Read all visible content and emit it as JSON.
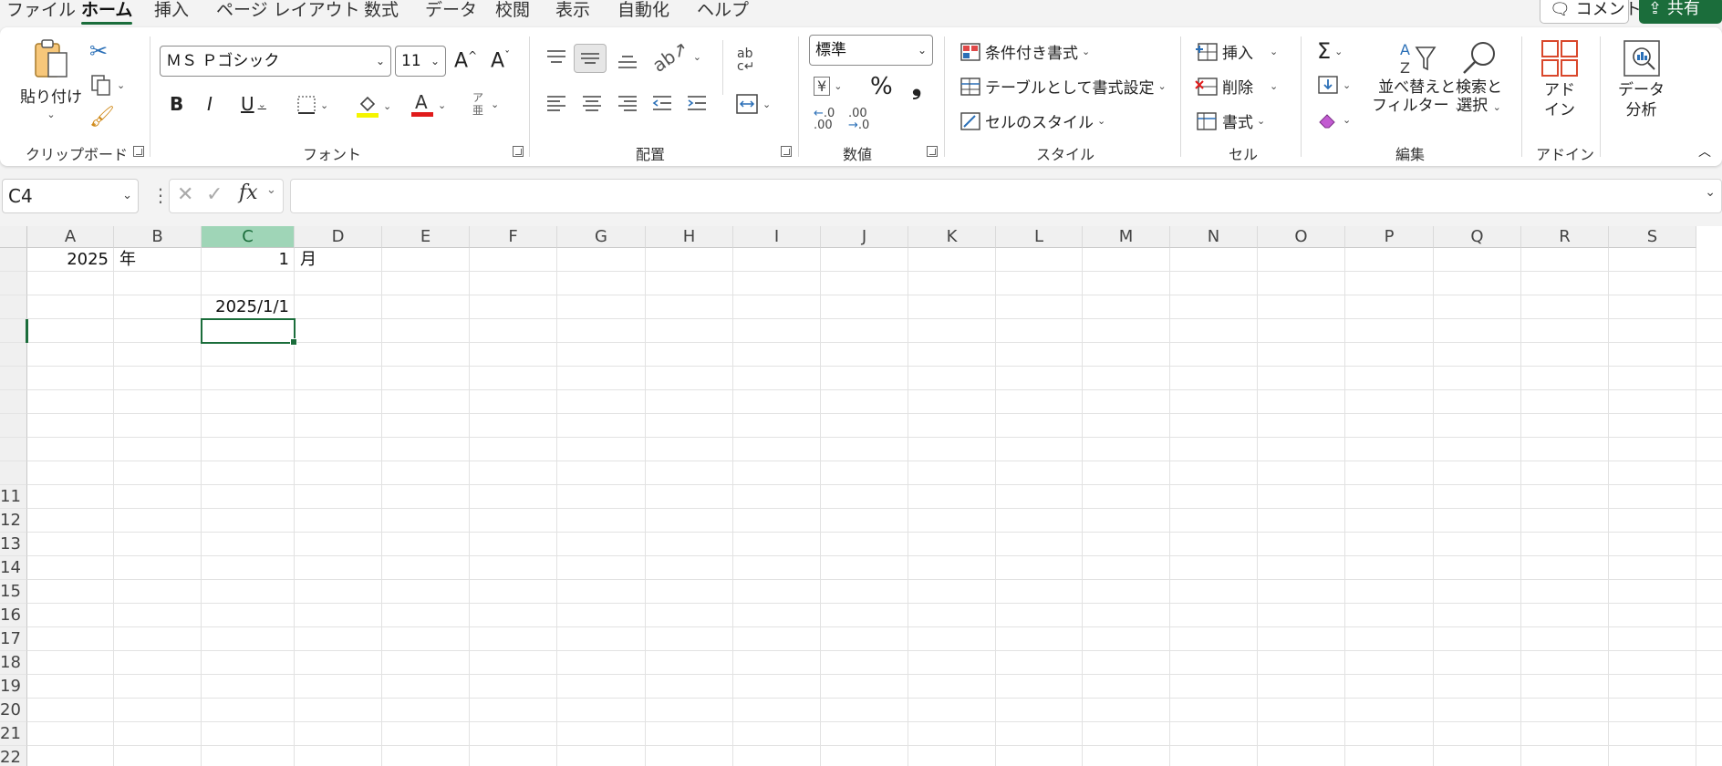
{
  "menu": {
    "tabs": [
      "ファイル",
      "ホーム",
      "挿入",
      "ページ レイアウト",
      "数式",
      "データ",
      "校閲",
      "表示",
      "自動化",
      "ヘルプ"
    ],
    "active": "ホーム",
    "comment_label": "コメント",
    "share_label": "共有"
  },
  "ribbon": {
    "clipboard": {
      "paste_label": "貼り付け",
      "group_label": "クリップボード"
    },
    "font": {
      "font_name": "ＭＳ Ｐゴシック",
      "font_size": "11",
      "group_label": "フォント",
      "bold": "B",
      "italic": "I",
      "underline": "U",
      "phonetic": "ア亜"
    },
    "alignment": {
      "group_label": "配置"
    },
    "number": {
      "format": "標準",
      "group_label": "数値",
      "percent": "%",
      "comma": "❟"
    },
    "styles": {
      "conditional": "条件付き書式",
      "table": "テーブルとして書式設定",
      "cell_styles": "セルのスタイル",
      "group_label": "スタイル"
    },
    "cells": {
      "insert": "挿入",
      "delete": "削除",
      "format": "書式",
      "group_label": "セル"
    },
    "editing": {
      "sort_line1": "並べ替えと",
      "sort_line2": "フィルター",
      "find_line1": "検索と",
      "find_line2": "選択",
      "group_label": "編集"
    },
    "addins": {
      "line1": "アド",
      "line2": "イン",
      "group_label": "アドイン"
    },
    "analysis": {
      "line1": "データ",
      "line2": "分析"
    }
  },
  "formula_bar": {
    "name_box": "C4",
    "fx": "fx",
    "formula": ""
  },
  "sheet": {
    "columns": [
      "A",
      "B",
      "C",
      "D",
      "E",
      "F",
      "G",
      "H",
      "I",
      "J",
      "K",
      "L",
      "M",
      "N",
      "O",
      "P",
      "Q",
      "R",
      "S"
    ],
    "selected_column": "C",
    "row_numbers": [
      "11",
      "12",
      "13",
      "14",
      "15",
      "16",
      "17",
      "18",
      "19",
      "20",
      "21",
      "22"
    ],
    "cells": {
      "A1": "2025",
      "B1": "年",
      "C1": "1",
      "D1": "月",
      "C3": "2025/1/1"
    },
    "active_cell": "C4"
  },
  "colors": {
    "accent": "#1b6d3b",
    "selected_header": "#9fd5b7"
  }
}
